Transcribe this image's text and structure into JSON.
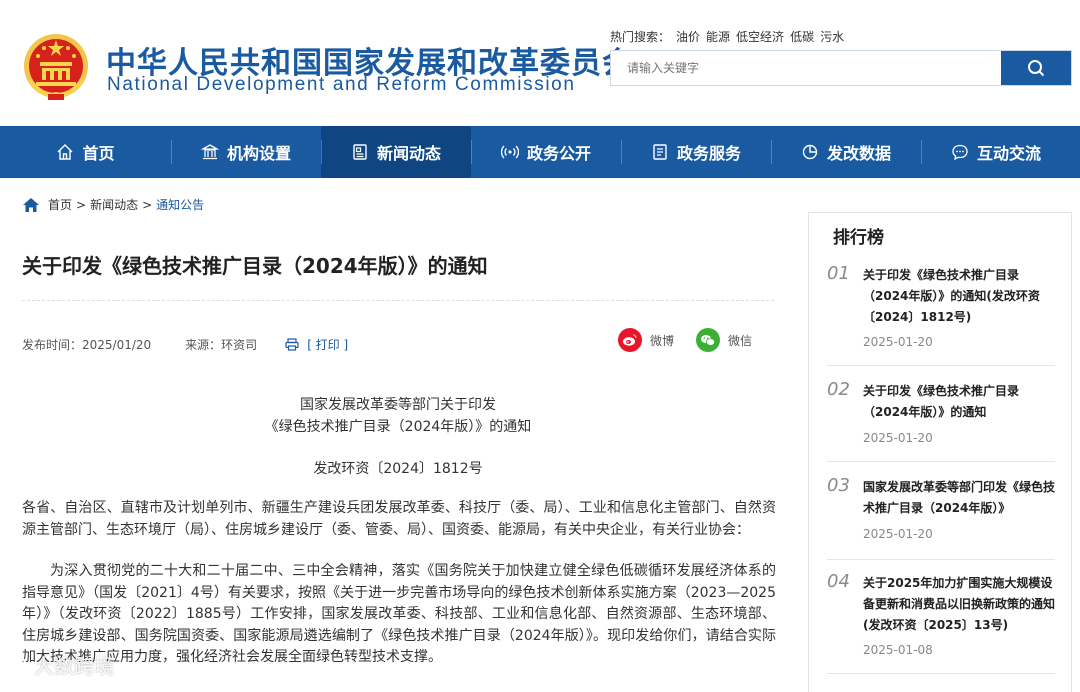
{
  "header": {
    "site_name_cn": "中华人民共和国国家发展和改革委员会",
    "site_name_en": "National Development and Reform Commission",
    "hot_search_label": "热门搜索：",
    "hot_keywords": [
      "油价",
      "能源",
      "低空经济",
      "低碳",
      "污水"
    ],
    "search_placeholder": "请输入关键字"
  },
  "nav": {
    "items": [
      {
        "label": "首页",
        "icon": "home-icon"
      },
      {
        "label": "机构设置",
        "icon": "building-icon"
      },
      {
        "label": "新闻动态",
        "icon": "news-icon",
        "active": true
      },
      {
        "label": "政务公开",
        "icon": "broadcast-icon"
      },
      {
        "label": "政务服务",
        "icon": "document-icon"
      },
      {
        "label": "发改数据",
        "icon": "pie-chart-icon"
      },
      {
        "label": "互动交流",
        "icon": "chat-icon"
      }
    ]
  },
  "breadcrumb": {
    "home": "首页",
    "level2": "新闻动态",
    "current": "通知公告",
    "sep": ">"
  },
  "article": {
    "title": "关于印发《绿色技术推广目录（2024年版）》的通知",
    "publish_time": "发布时间：2025/01/20",
    "source": "来源：环资司",
    "print": "[ 打印 ]",
    "share_weibo": "微博",
    "share_wechat": "微信",
    "doc_heading_1": "国家发展改革委等部门关于印发",
    "doc_heading_2": "《绿色技术推广目录（2024年版）》的通知",
    "doc_number": "发改环资〔2024〕1812号",
    "para1": "各省、自治区、直辖市及计划单列市、新疆生产建设兵团发展改革委、科技厅（委、局）、工业和信息化主管部门、自然资源主管部门、生态环境厅（局）、住房城乡建设厅（委、管委、局）、国资委、能源局，有关中央企业，有关行业协会：",
    "para2": "为深入贯彻党的二十大和二十届二中、三中全会精神，落实《国务院关于加快建立健全绿色低碳循环发展经济体系的指导意见》（国发〔2021〕4号）有关要求，按照《关于进一步完善市场导向的绿色技术创新体系实施方案（2023—2025年）》（发改环资〔2022〕1885号）工作安排，国家发展改革委、科技部、工业和信息化部、自然资源部、生态环境部、住房城乡建设部、国务院国资委、国家能源局遴选编制了《绿色技术推广目录（2024年版）》。现印发给你们，请结合实际加大技术推广应用力度，强化经济社会发展全面绿色转型技术支撑。"
  },
  "sidebar": {
    "title": "排行榜",
    "items": [
      {
        "num": "01",
        "title": "关于印发《绿色技术推广目录（2024年版）》的通知(发改环资〔2024〕1812号)",
        "date": "2025-01-20"
      },
      {
        "num": "02",
        "title": "关于印发《绿色技术推广目录（2024年版）》的通知",
        "date": "2025-01-20"
      },
      {
        "num": "03",
        "title": "国家发展改革委等部门印发《绿色技术推广目录（2024年版）》",
        "date": "2025-01-20"
      },
      {
        "num": "04",
        "title": "关于2025年加力扩围实施大规模设备更新和消费品以旧换新政策的通知(发改环资〔2025〕13号)",
        "date": "2025-01-08"
      }
    ]
  },
  "watermark": "大数跨境",
  "colors": {
    "brand_blue": "#1a5aa0",
    "nav_active": "#0f4580",
    "weibo_red": "#e6162d",
    "wechat_green": "#3cb034"
  }
}
